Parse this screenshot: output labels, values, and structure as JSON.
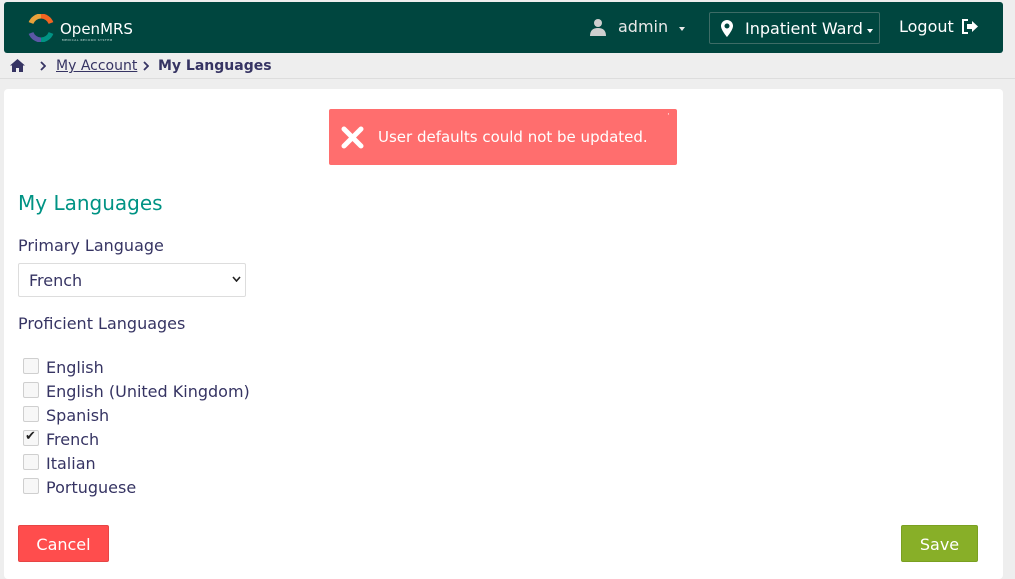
{
  "header": {
    "logo_text": "OpenMRS",
    "logo_subtext": "MEDICAL RECORD SYSTEM",
    "user_label": "admin",
    "location_label": "Inpatient Ward",
    "logout_label": "Logout"
  },
  "breadcrumb": {
    "link_label": "My Account",
    "current_label": "My Languages"
  },
  "alert": {
    "message": "User defaults could not be updated.",
    "close_glyph": "·"
  },
  "form": {
    "title": "My Languages",
    "primary_label": "Primary Language",
    "primary_value": "French",
    "proficient_label": "Proficient Languages",
    "languages": [
      {
        "label": "English",
        "checked": false
      },
      {
        "label": "English (United Kingdom)",
        "checked": false
      },
      {
        "label": "Spanish",
        "checked": false
      },
      {
        "label": "French",
        "checked": true
      },
      {
        "label": "Italian",
        "checked": false
      },
      {
        "label": "Portuguese",
        "checked": false
      }
    ]
  },
  "buttons": {
    "cancel_label": "Cancel",
    "save_label": "Save"
  },
  "colors": {
    "header_bg": "#00463f",
    "title_teal": "#009384",
    "alert_red": "#ff6e6e",
    "cancel_red": "#ff4d4d",
    "save_green": "#88af28"
  }
}
